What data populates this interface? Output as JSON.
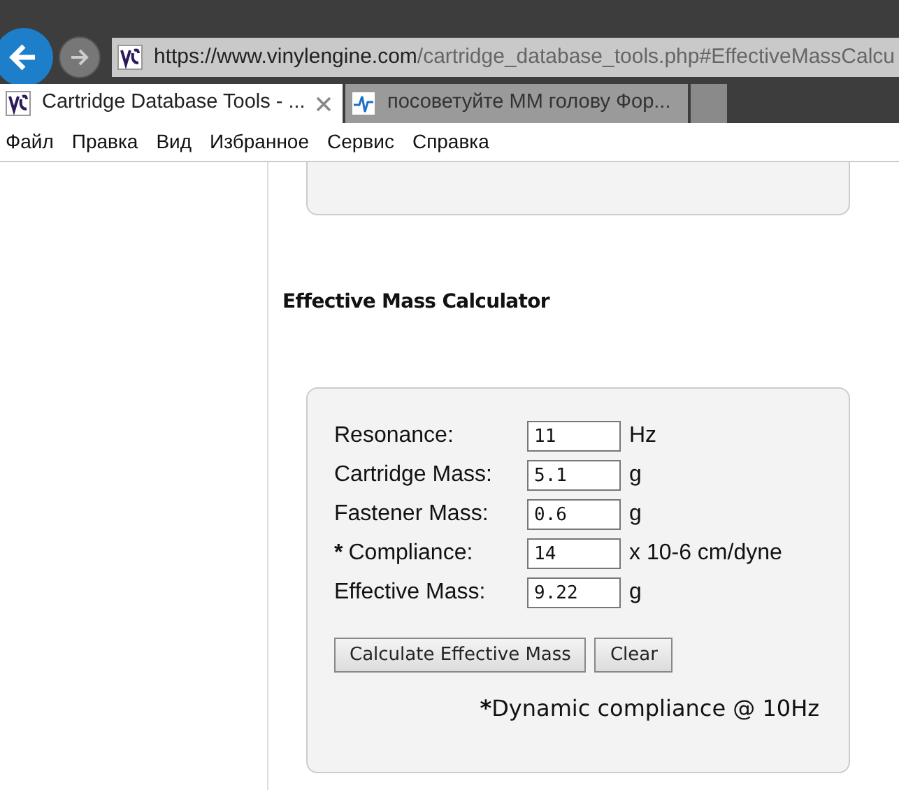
{
  "browser": {
    "url_host": "https://www.vinylengine.com",
    "url_path": "/cartridge_database_tools.php#EffectiveMassCalcu",
    "tabs": [
      {
        "title": "Cartridge Database Tools - ...",
        "selected": true,
        "closable": true,
        "kind": "site"
      },
      {
        "title": "посоветуйте ММ голову Фор...",
        "selected": false,
        "closable": false,
        "kind": "wave"
      }
    ]
  },
  "menu": [
    "Файл",
    "Правка",
    "Вид",
    "Избранное",
    "Сервис",
    "Справка"
  ],
  "section_title": "Effective Mass Calculator",
  "fields": [
    {
      "label": "Resonance:",
      "value": "11",
      "unit": "Hz"
    },
    {
      "label": "Cartridge Mass:",
      "value": "5.1",
      "unit": "g"
    },
    {
      "label": "Fastener Mass:",
      "value": "0.6",
      "unit": "g"
    },
    {
      "marker": "*",
      "label": "Compliance:",
      "value": "14",
      "unit": "x 10-6 cm/dyne"
    },
    {
      "label": "Effective Mass:",
      "value": "9.22",
      "unit": "g"
    }
  ],
  "buttons": [
    "Calculate Effective Mass",
    "Clear"
  ],
  "footnote": {
    "marker": "*",
    "text": "Dynamic compliance @ 10Hz"
  }
}
